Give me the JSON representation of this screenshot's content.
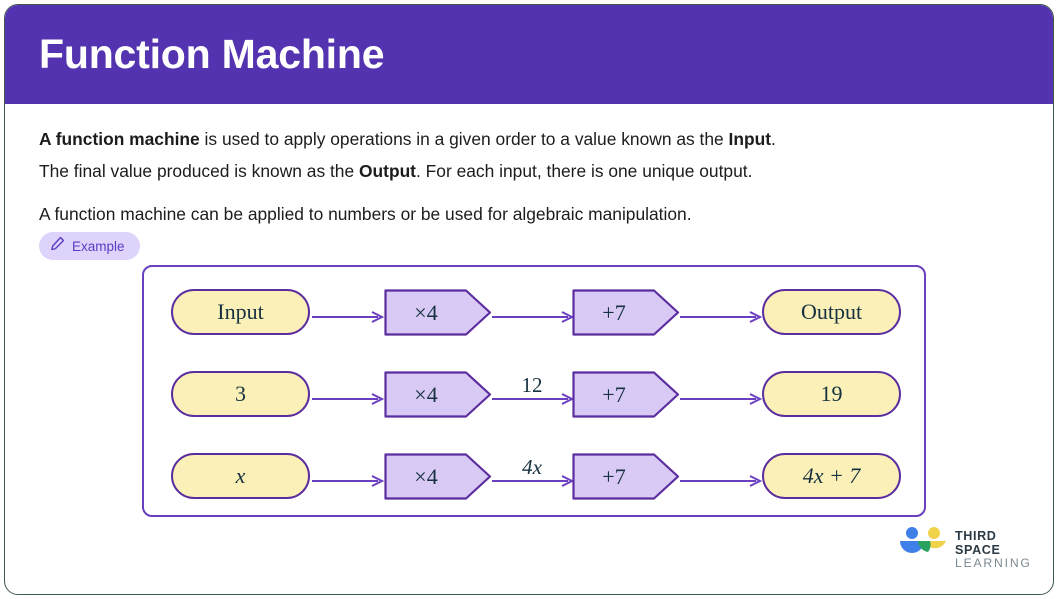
{
  "header": {
    "title": "Function Machine",
    "bg_color": "#5333b0"
  },
  "body": {
    "paragraph1": {
      "bold1": "A function machine",
      "text1": " is used to apply operations in a given order to a value known as the ",
      "bold2": "Input",
      "text2": ".",
      "line2_pre": "The final value produced is known as the ",
      "line2_bold": "Output",
      "line2_post": ". For each input, there is one unique output."
    },
    "paragraph2": "A function machine can be applied to numbers or be used for algebraic manipulation."
  },
  "example_badge": {
    "label": "Example",
    "icon": "pencil-icon",
    "bg_color": "#ddd3fb",
    "text_color": "#5b3cc4"
  },
  "diagram": {
    "border_color": "#6a3fc0",
    "pill_fill": "#fbf0b8",
    "pill_border": "#5b2d9e",
    "op_fill": "#d8c9f5",
    "op_border": "#5b2d9e",
    "text_color": "#16313f",
    "arrow_color": "#6a3fc0",
    "rows": [
      {
        "input": "Input",
        "op1": "×4",
        "middle": "",
        "op2": "+7",
        "output": "Output",
        "italic_input": false,
        "italic_middle": false,
        "italic_output": false
      },
      {
        "input": "3",
        "op1": "×4",
        "middle": "12",
        "op2": "+7",
        "output": "19",
        "italic_input": false,
        "italic_middle": false,
        "italic_output": false
      },
      {
        "input": "x",
        "op1": "×4",
        "middle": "4x",
        "op2": "+7",
        "output": "4x + 7",
        "italic_input": true,
        "italic_middle": true,
        "italic_output": true
      }
    ]
  },
  "logo": {
    "line1": "THIRD SPACE",
    "line2": "LEARNING",
    "blue": "#3f7fe8",
    "yellow": "#f0d24b",
    "green": "#2aa25f"
  }
}
